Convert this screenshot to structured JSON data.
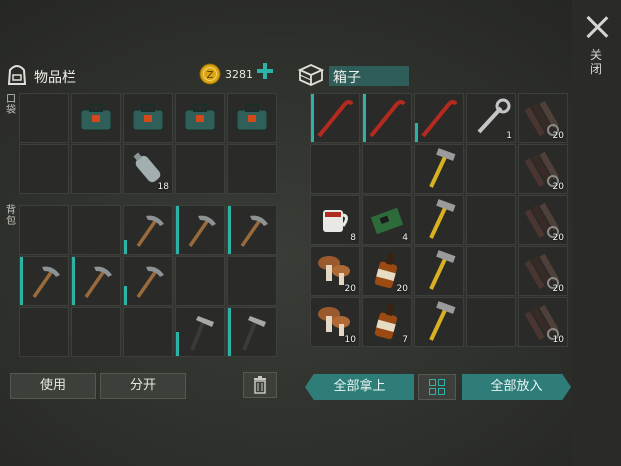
{
  "close": {
    "label": "关闭"
  },
  "inventory": {
    "title": "物品栏",
    "coins": "3281",
    "pocket_label": "口袋",
    "backpack_label": "背包",
    "use_label": "使用",
    "split_label": "分开",
    "pocket": [
      {
        "icon": "",
        "count": ""
      },
      {
        "icon": "toolbox",
        "count": ""
      },
      {
        "icon": "toolbox",
        "count": ""
      },
      {
        "icon": "toolbox",
        "count": ""
      },
      {
        "icon": "toolbox",
        "count": ""
      },
      {
        "icon": "",
        "count": ""
      },
      {
        "icon": "",
        "count": ""
      },
      {
        "icon": "bottle",
        "count": "18"
      },
      {
        "icon": "",
        "count": ""
      },
      {
        "icon": "",
        "count": ""
      }
    ],
    "backpack": [
      {
        "icon": "",
        "count": ""
      },
      {
        "icon": "",
        "count": ""
      },
      {
        "icon": "pickaxe",
        "count": "",
        "bar": 0.3
      },
      {
        "icon": "pickaxe",
        "count": "",
        "bar": 1
      },
      {
        "icon": "pickaxe",
        "count": "",
        "bar": 1
      },
      {
        "icon": "pickaxe",
        "count": "",
        "bar": 1
      },
      {
        "icon": "pickaxe",
        "count": "",
        "bar": 1
      },
      {
        "icon": "pickaxe",
        "count": "",
        "bar": 0.4
      },
      {
        "icon": "",
        "count": ""
      },
      {
        "icon": "",
        "count": ""
      },
      {
        "icon": "",
        "count": ""
      },
      {
        "icon": "",
        "count": ""
      },
      {
        "icon": "",
        "count": ""
      },
      {
        "icon": "hammer-axe",
        "count": "",
        "bar": 0.5
      },
      {
        "icon": "hammer-axe",
        "count": "",
        "bar": 1
      }
    ]
  },
  "box": {
    "title": "箱子",
    "take_all": "全部拿上",
    "put_all": "全部放入",
    "slots": [
      {
        "icon": "crowbar",
        "count": "",
        "bar": 1
      },
      {
        "icon": "crowbar",
        "count": "",
        "bar": 1
      },
      {
        "icon": "crowbar",
        "count": "",
        "bar": 0.4
      },
      {
        "icon": "wrench",
        "count": "1"
      },
      {
        "icon": "spark-plugs",
        "count": "20"
      },
      {
        "icon": "",
        "count": ""
      },
      {
        "icon": "",
        "count": ""
      },
      {
        "icon": "hammer",
        "count": ""
      },
      {
        "icon": "",
        "count": ""
      },
      {
        "icon": "spark-plugs",
        "count": "20"
      },
      {
        "icon": "mug",
        "count": "8"
      },
      {
        "icon": "circuit-board",
        "count": "4"
      },
      {
        "icon": "hammer",
        "count": ""
      },
      {
        "icon": "",
        "count": ""
      },
      {
        "icon": "spark-plugs",
        "count": "20"
      },
      {
        "icon": "mushrooms",
        "count": "20"
      },
      {
        "icon": "whiskey",
        "count": "20"
      },
      {
        "icon": "hammer",
        "count": ""
      },
      {
        "icon": "",
        "count": ""
      },
      {
        "icon": "spark-plugs",
        "count": "20"
      },
      {
        "icon": "mushrooms",
        "count": "10"
      },
      {
        "icon": "whiskey",
        "count": "7"
      },
      {
        "icon": "hammer",
        "count": ""
      },
      {
        "icon": "",
        "count": ""
      },
      {
        "icon": "spark-plugs",
        "count": "10"
      }
    ]
  },
  "colors": {
    "accent": "#2bb3a8",
    "teal_button": "#2f7d78",
    "coin": "#d9a514"
  }
}
